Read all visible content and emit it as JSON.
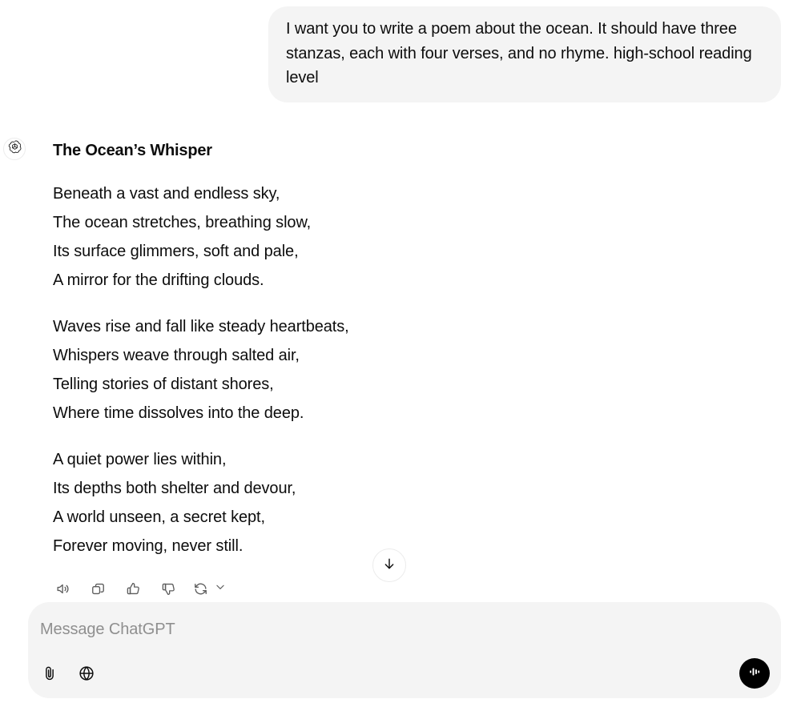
{
  "conversation": {
    "user_message": {
      "text": "I want you to write a poem about the ocean. It should have three stanzas, each with four verses, and no rhyme. high-school reading level"
    },
    "assistant_message": {
      "avatar_icon": "openai-logo-icon",
      "title": "The Ocean’s Whisper",
      "stanzas": [
        {
          "verses": [
            "Beneath a vast and endless sky,",
            "The ocean stretches, breathing slow,",
            "Its surface glimmers, soft and pale,",
            "A mirror for the drifting clouds."
          ]
        },
        {
          "verses": [
            "Waves rise and fall like steady heartbeats,",
            "Whispers weave through salted air,",
            "Telling stories of distant shores,",
            "Where time dissolves into the deep."
          ]
        },
        {
          "verses": [
            "A quiet power lies within,",
            "Its depths both shelter and devour,",
            "A world unseen, a secret kept,",
            "Forever moving, never still."
          ]
        }
      ],
      "actions": [
        {
          "name": "read-aloud",
          "icon": "speaker-icon",
          "label": "Read aloud"
        },
        {
          "name": "copy",
          "icon": "copy-icon",
          "label": "Copy"
        },
        {
          "name": "good-response",
          "icon": "thumbs-up-icon",
          "label": "Good response"
        },
        {
          "name": "bad-response",
          "icon": "thumbs-down-icon",
          "label": "Bad response"
        },
        {
          "name": "regenerate",
          "icon": "refresh-icon",
          "label": "Regenerate"
        },
        {
          "name": "regenerate-menu",
          "icon": "chevron-down-icon",
          "label": "More model options"
        }
      ]
    }
  },
  "scroll_to_bottom": {
    "icon": "arrow-down-icon",
    "label": "Scroll to bottom"
  },
  "composer": {
    "placeholder": "Message ChatGPT",
    "value": "",
    "attach_icon": "paperclip-icon",
    "attach_label": "Attach files",
    "search_icon": "globe-icon",
    "search_label": "Search the web",
    "voice_icon": "voice-waveform-icon",
    "voice_label": "Voice mode"
  },
  "colors": {
    "page_background": "#ffffff",
    "bubble_background": "#f4f4f4",
    "composer_background": "#f4f4f4",
    "text_primary": "#0d0d0d",
    "text_muted": "#8f8f8f",
    "icon_muted": "#5d5d5d",
    "voice_button": "#000000"
  }
}
